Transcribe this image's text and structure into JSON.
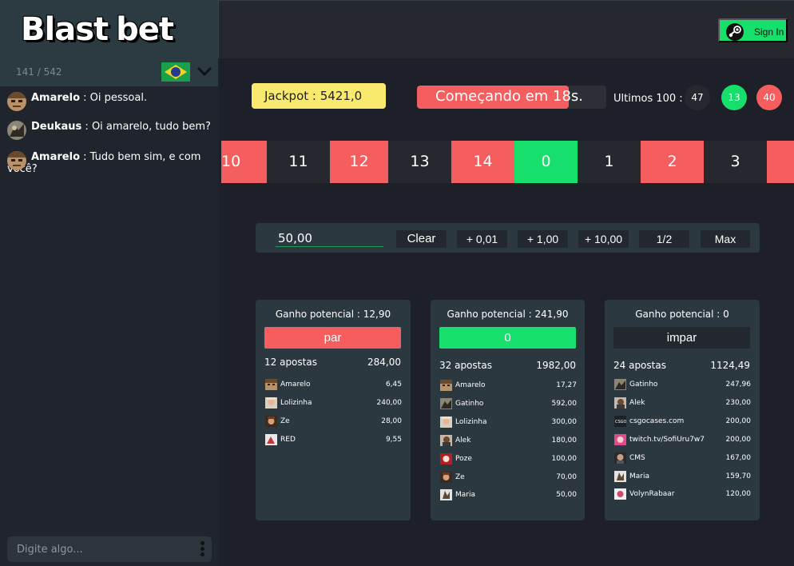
{
  "logo": {
    "word1": "Blast",
    "word2": "bet"
  },
  "sidebar": {
    "online_count": "141 / 542",
    "messages": [
      {
        "user": "Amarelo",
        "separator": " : ",
        "text": "Oi pessoal."
      },
      {
        "user": "Deukaus",
        "separator": " : ",
        "text": "Oi amarelo, tudo bem?"
      },
      {
        "user": "Amarelo",
        "separator": " : ",
        "text": " Tudo bem sim, e com você?"
      }
    ],
    "input_placeholder": "Digite algo..."
  },
  "header": {
    "signin_label": "Sign In"
  },
  "jackpot": {
    "label": "Jackpot : ",
    "value": "5421,0"
  },
  "countdown": {
    "text": "Começando em 18s.",
    "progress": 0.8
  },
  "last100": {
    "label": "Ultimos 100 :",
    "values": [
      "47",
      "13",
      "40"
    ]
  },
  "roulette": {
    "cells": [
      "10",
      "11",
      "12",
      "13",
      "14",
      "0",
      "1",
      "2",
      "3",
      ""
    ]
  },
  "bet_controls": {
    "amount": "50,00",
    "buttons": [
      "Clear",
      "+ 0,01",
      "+ 1,00",
      "+ 10,00",
      "1/2",
      "Max"
    ]
  },
  "panels": [
    {
      "title": "Ganho potencial : 12,90",
      "button": "par",
      "count": "12 apostas",
      "total": "284,00",
      "bets": [
        {
          "name": "Amarelo",
          "value": "6,45"
        },
        {
          "name": "Lolizinha",
          "value": "240,00"
        },
        {
          "name": "Ze",
          "value": "28,00"
        },
        {
          "name": "RED",
          "value": "9,55"
        }
      ]
    },
    {
      "title": "Ganho potencial : 241,90",
      "button": "0",
      "count": "32 apostas",
      "total": "1982,00",
      "bets": [
        {
          "name": "Amarelo",
          "value": "17,27"
        },
        {
          "name": "Gatinho",
          "value": "592,00"
        },
        {
          "name": "Lolizinha",
          "value": "300,00"
        },
        {
          "name": "Alek",
          "value": "180,00"
        },
        {
          "name": "Poze",
          "value": "100,00"
        },
        {
          "name": "Ze",
          "value": "70,00"
        },
        {
          "name": "Maria",
          "value": "50,00"
        }
      ]
    },
    {
      "title": "Ganho potencial : 0",
      "button": "impar",
      "count": "24 apostas",
      "total": "1124,49",
      "bets": [
        {
          "name": "Gatinho",
          "value": "247,96"
        },
        {
          "name": "Alek",
          "value": "230,00"
        },
        {
          "name": "csgocases.com",
          "value": "200,00"
        },
        {
          "name": "twitch.tv/SofiUru7w7",
          "value": "200,00"
        },
        {
          "name": "CMS",
          "value": "167,00"
        },
        {
          "name": "Maria",
          "value": "159,70"
        },
        {
          "name": "VolynRabaar",
          "value": "120,00"
        }
      ]
    }
  ],
  "colors": {
    "red": "#f45e5e",
    "green": "#17df6c",
    "dark": "#25292f",
    "jackpot": "#f9ea6f",
    "panel": "#2c3840"
  },
  "icons": [
    "brazil-flag-icon",
    "chevron-down-icon",
    "steam-icon",
    "more-vertical-icon"
  ]
}
